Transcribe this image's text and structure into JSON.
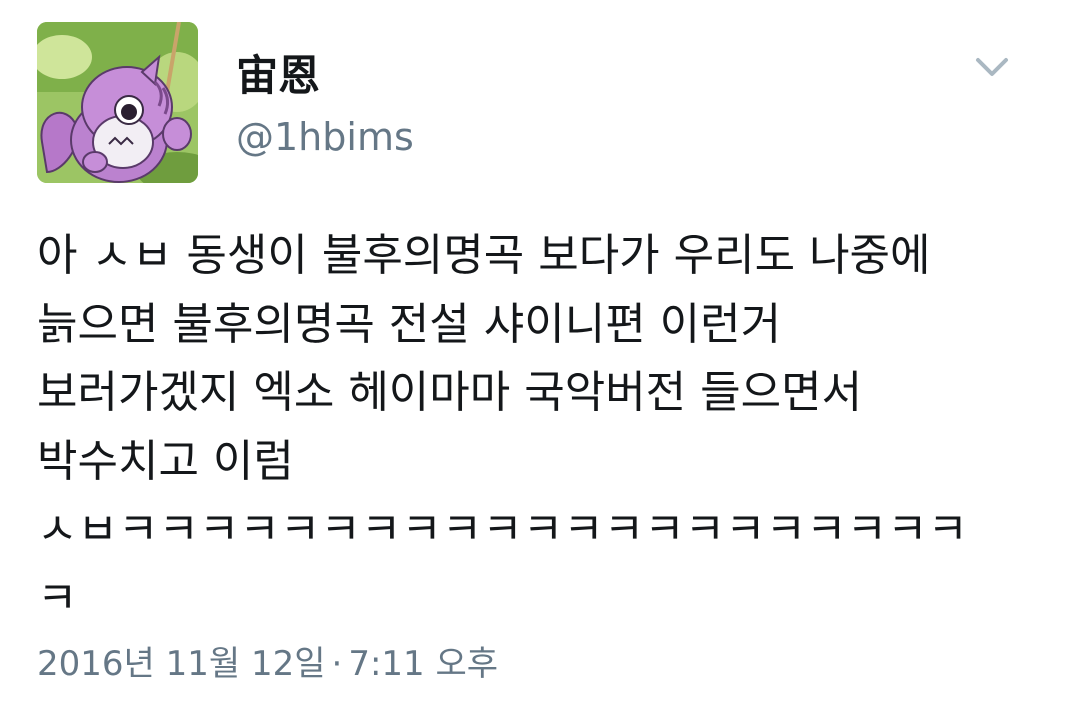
{
  "author": {
    "display_name": "宙恩",
    "handle": "@1hbims",
    "avatar_icon": "purple-squirrel-cartoon-avatar"
  },
  "menu_icon": "chevron-down-icon",
  "tweet": {
    "lines": [
      "아 ㅅㅂ 동생이 불후의명곡 보다가 우리도 나중에",
      "늙으면 불후의명곡 전설 샤이니편 이런거",
      "보러가겠지 엑소 헤이마마 국악버전 들으면서",
      "박수치고 이럼",
      "ㅅㅂㅋㅋㅋㅋㅋㅋㅋㅋㅋㅋㅋㅋㅋㅋㅋㅋㅋㅋㅋㅋㅋ",
      "ㅋ"
    ]
  },
  "meta": {
    "date": "2016년 11월 12일",
    "separator": "·",
    "time": "7:11 오후"
  },
  "colors": {
    "text": "#14171a",
    "secondary": "#657786",
    "caret": "#aab8c2",
    "background": "#ffffff"
  }
}
